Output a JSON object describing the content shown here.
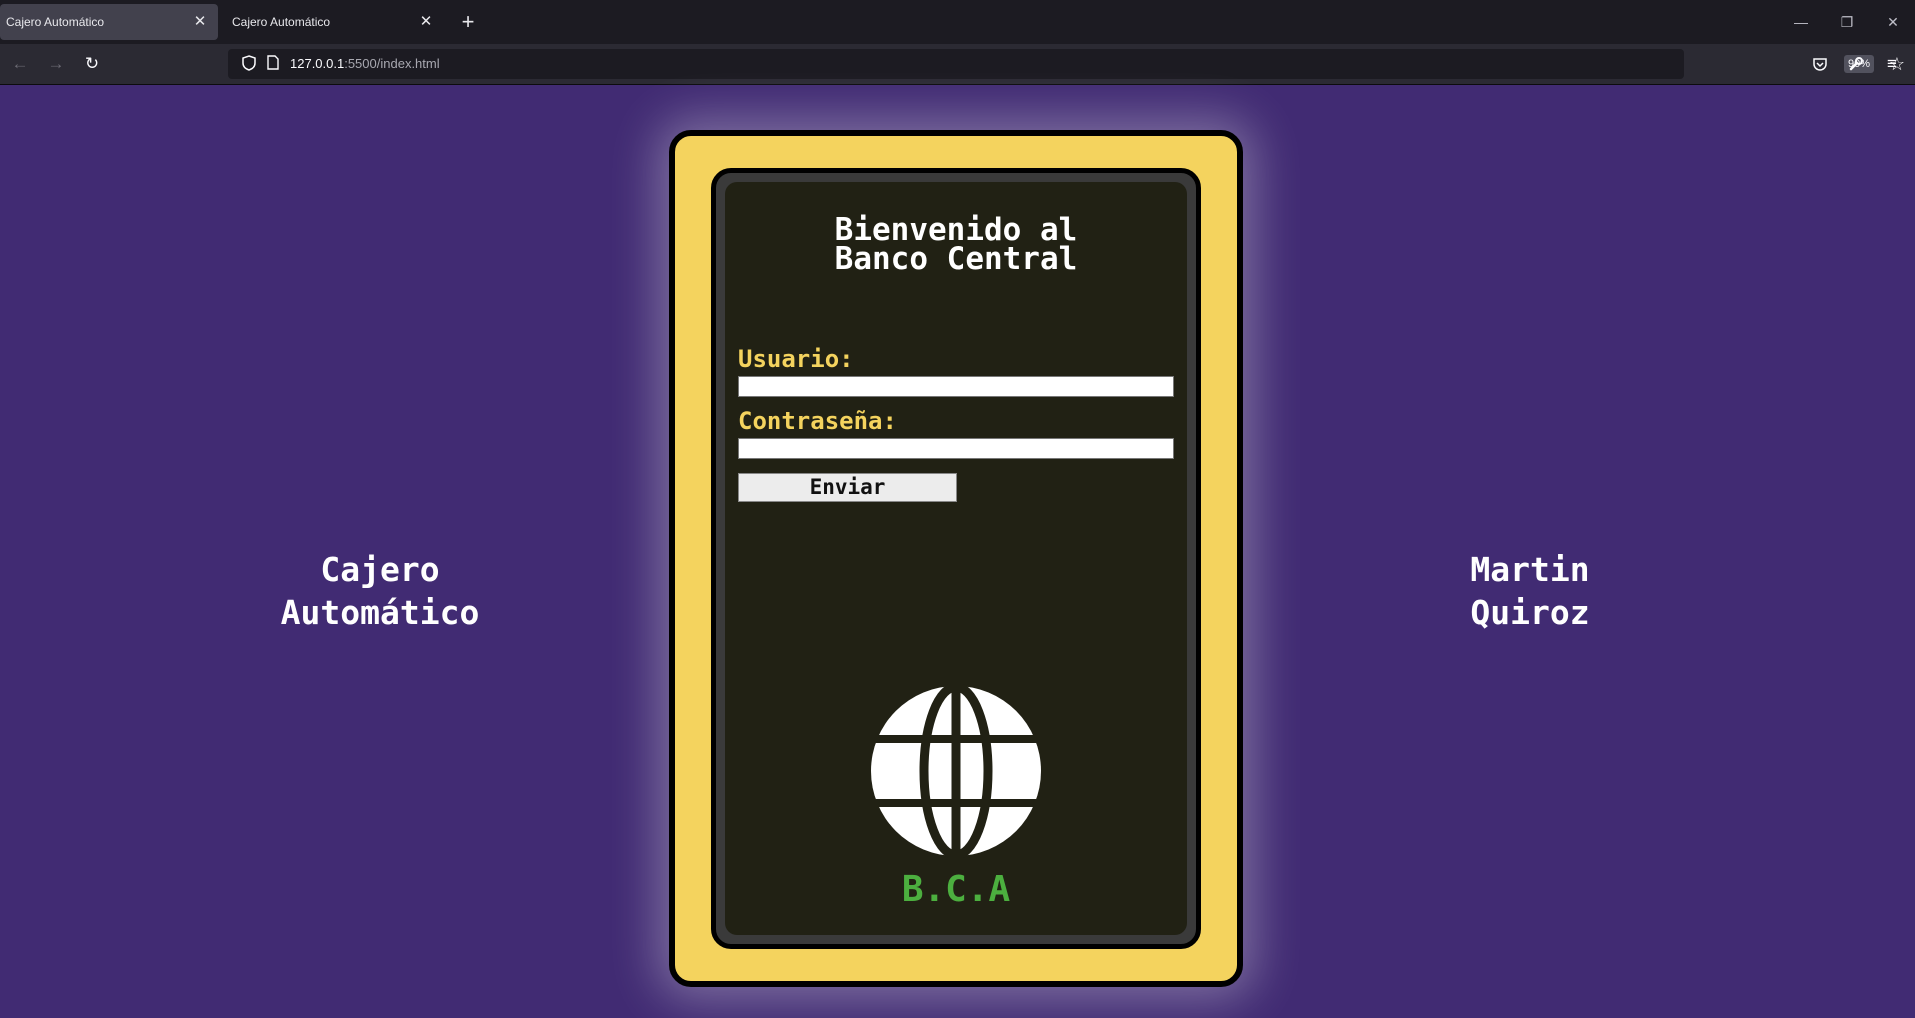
{
  "browser": {
    "tabs": [
      {
        "title": "Cajero Automático",
        "active": true
      },
      {
        "title": "Cajero Automático",
        "active": false
      }
    ],
    "url_host": "127.0.0.1",
    "url_path": ":5500/index.html",
    "zoom": "90%",
    "icons": {
      "close": "close-icon",
      "new_tab": "plus-icon",
      "back": "arrow-left-icon",
      "forward": "arrow-right-icon",
      "reload": "reload-icon",
      "shield": "shield-icon",
      "page": "page-icon",
      "bookmark": "star-icon",
      "pocket": "pocket-icon",
      "tools": "wrench-icon",
      "menu": "hamburger-icon",
      "minimize": "minimize-icon",
      "restore": "restore-icon",
      "window_close": "window-close-icon"
    }
  },
  "page": {
    "left_title": "Cajero\nAutomático",
    "right_title": "Martin\nQuiroz",
    "welcome": "Bienvenido al\nBanco Central",
    "user_label": "Usuario:",
    "user_value": "",
    "password_label": "Contraseña:",
    "password_value": "",
    "submit_label": "Enviar",
    "bank_abbrev": "B.C.A",
    "logo_icon": "globe-icon"
  },
  "colors": {
    "page_background": "#412b73",
    "atm_body": "#f4d35e",
    "atm_screen": "#212114",
    "label_text": "#f4d35e",
    "abbrev_text": "#4caf3f"
  }
}
